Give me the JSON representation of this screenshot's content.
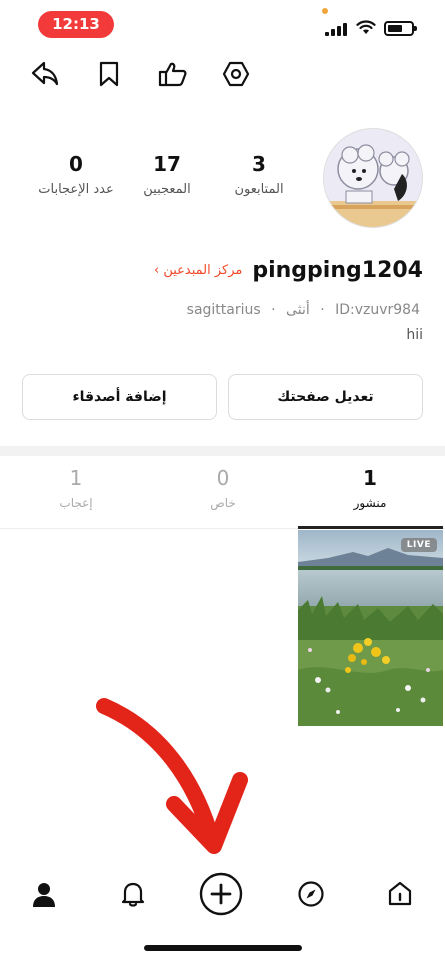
{
  "status_bar": {
    "time": "12:13"
  },
  "profile": {
    "stats": [
      {
        "value": "3",
        "label": "المتابعون"
      },
      {
        "value": "17",
        "label": "المعجبين"
      },
      {
        "value": "0",
        "label": "عدد الإعجابات"
      }
    ],
    "username": "pingping1204",
    "creator_center": "مركز المبدعين ›",
    "user_id": "ID:vzuvr984",
    "gender": "أنثى",
    "zodiac": "sagittarius",
    "separator": "·",
    "bio": "hii"
  },
  "buttons": {
    "edit_profile": "تعديل صفحتك",
    "add_friends": "إضافة أصدقاء"
  },
  "tabs": [
    {
      "count": "1",
      "label": "منشور"
    },
    {
      "count": "0",
      "label": "خاص"
    },
    {
      "count": "1",
      "label": "إعجاب"
    }
  ],
  "post": {
    "badge": "LIVE"
  },
  "icons": {
    "top": [
      "share-icon",
      "bookmark-icon",
      "thumbs-up-icon",
      "settings-icon"
    ],
    "nav": [
      "profile-icon",
      "notifications-icon",
      "create-icon",
      "explore-icon",
      "home-icon"
    ]
  },
  "colors": {
    "accent": "#ef4a2a",
    "time_pill": "#f23a3a",
    "arrow": "#e32419"
  }
}
